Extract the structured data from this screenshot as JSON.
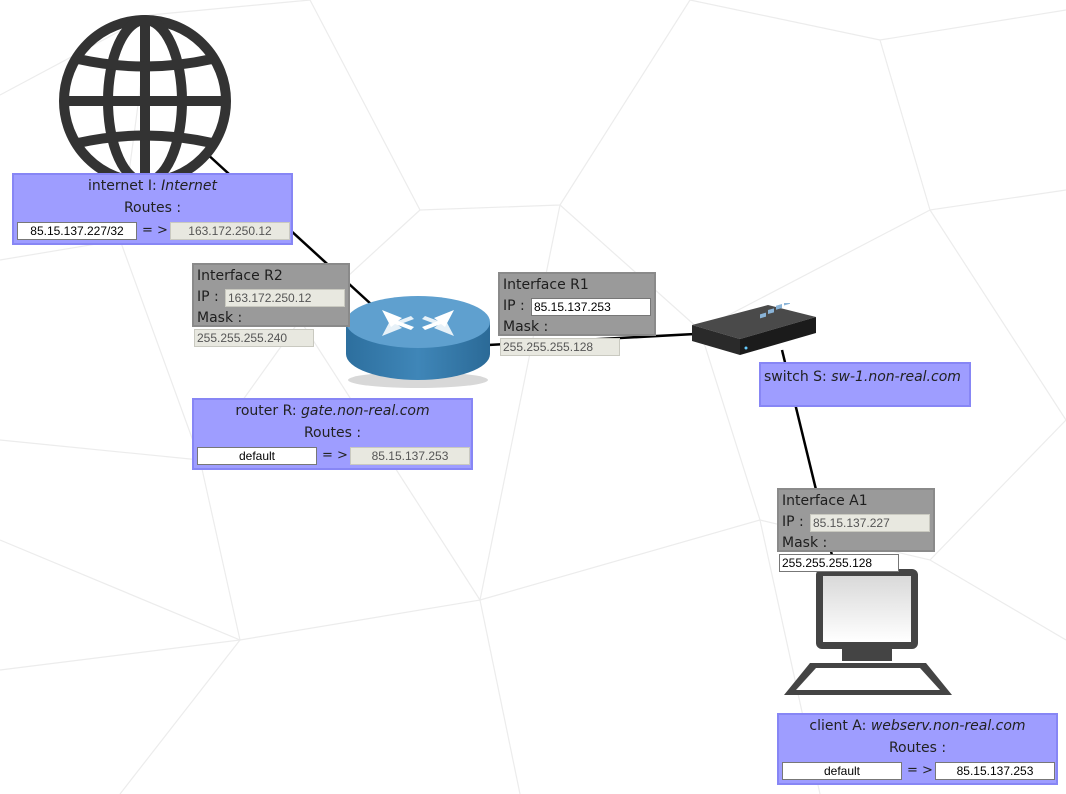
{
  "internet": {
    "title_prefix": "internet I: ",
    "title_name": "Internet",
    "routes_label": "Routes :",
    "route_dest": "85.15.137.227/32",
    "route_arrow": "= >",
    "route_gateway": "163.172.250.12"
  },
  "router": {
    "title_prefix": "router R: ",
    "title_name": "gate.non-real.com",
    "routes_label": "Routes :",
    "route_dest": "default",
    "route_arrow": "= >",
    "route_gateway": "85.15.137.253"
  },
  "interface_r2": {
    "title": "Interface R2",
    "ip_label": "IP :",
    "ip": "163.172.250.12",
    "mask_label": "Mask :",
    "mask": "255.255.255.240"
  },
  "interface_r1": {
    "title": "Interface R1",
    "ip_label": "IP :",
    "ip": "85.15.137.253",
    "mask_label": "Mask :",
    "mask": "255.255.255.128"
  },
  "switch": {
    "title_prefix": "switch S: ",
    "title_name": "sw-1.non-real.com"
  },
  "interface_a1": {
    "title": "Interface A1",
    "ip_label": "IP :",
    "ip": "85.15.137.227",
    "mask_label": "Mask :",
    "mask": "255.255.255.128"
  },
  "client": {
    "title_prefix": "client A: ",
    "title_name": "webserv.non-real.com",
    "routes_label": "Routes :",
    "route_dest": "default",
    "route_arrow": "= >",
    "route_gateway": "85.15.137.253"
  },
  "icons": {
    "internet": "globe-icon",
    "router": "router-icon",
    "switch": "switch-icon",
    "client": "computer-icon"
  },
  "colors": {
    "device_card": "#9e9dff",
    "interface_card": "#9a9a9a",
    "link": "#000000",
    "router_body": "#3f86b8"
  }
}
